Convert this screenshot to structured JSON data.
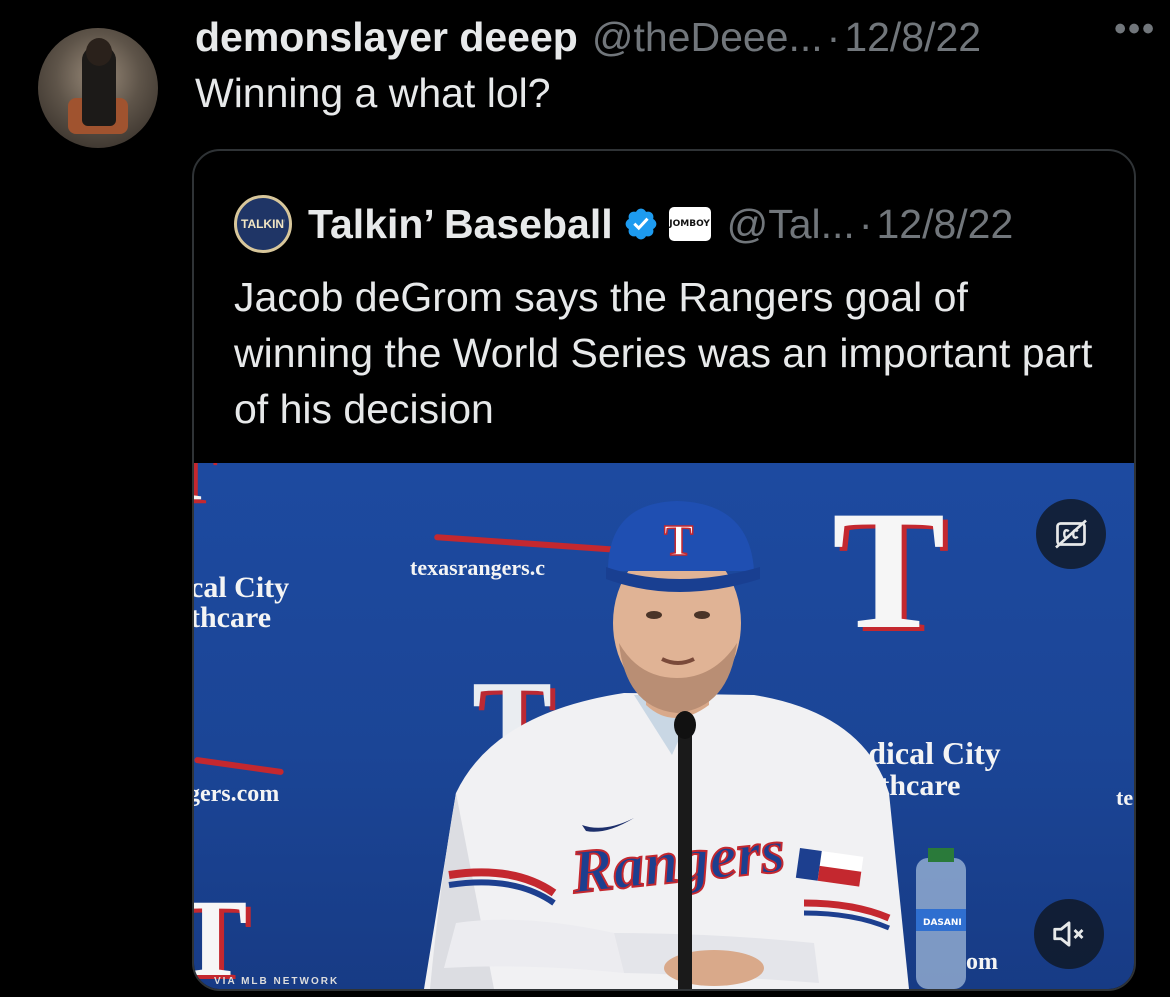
{
  "tweet": {
    "display_name": "demonslayer deeep",
    "handle": "@theDeee...",
    "separator": "·",
    "date": "12/8/22",
    "more_icon": "more-horizontal-icon",
    "text": "Winning a what lol?"
  },
  "quote": {
    "logo_text": "TALKIN' Baseball",
    "display_name": "Talkin’ Baseball",
    "verified_icon": "verified-badge-icon",
    "verified_color": "#1d9bf0",
    "affiliate_badge": "JOMBOY",
    "handle": "@Tal...",
    "separator": "·",
    "date": "12/8/22",
    "text": "Jacob deGrom says the Rangers goal of winning the World Series was an important part of his decision"
  },
  "media": {
    "type": "video",
    "backdrop_texts": {
      "sponsor_left_1": "cal City",
      "sponsor_left_2": "thcare",
      "site_top": "texasrangers.c",
      "site_left": "gers.com",
      "sponsor_right_1": "edical City",
      "sponsor_right_2": "althcare",
      "site_right_edge": "te",
      "site_bottom": "om",
      "network_credit": "VIA MLB NETWORK",
      "bottle_label": "DASANI",
      "jersey_script": "Rangers",
      "cap_letter": "T",
      "logo_letter": "T"
    },
    "cc_icon": "captions-off-icon",
    "mute_icon": "volume-muted-icon"
  },
  "colors": {
    "background": "#000000",
    "text_primary": "#e7e9ea",
    "text_secondary": "#71767b",
    "border": "#2f3336",
    "backdrop_blue": "#1d4aa0",
    "rangers_red": "#c4282f"
  }
}
